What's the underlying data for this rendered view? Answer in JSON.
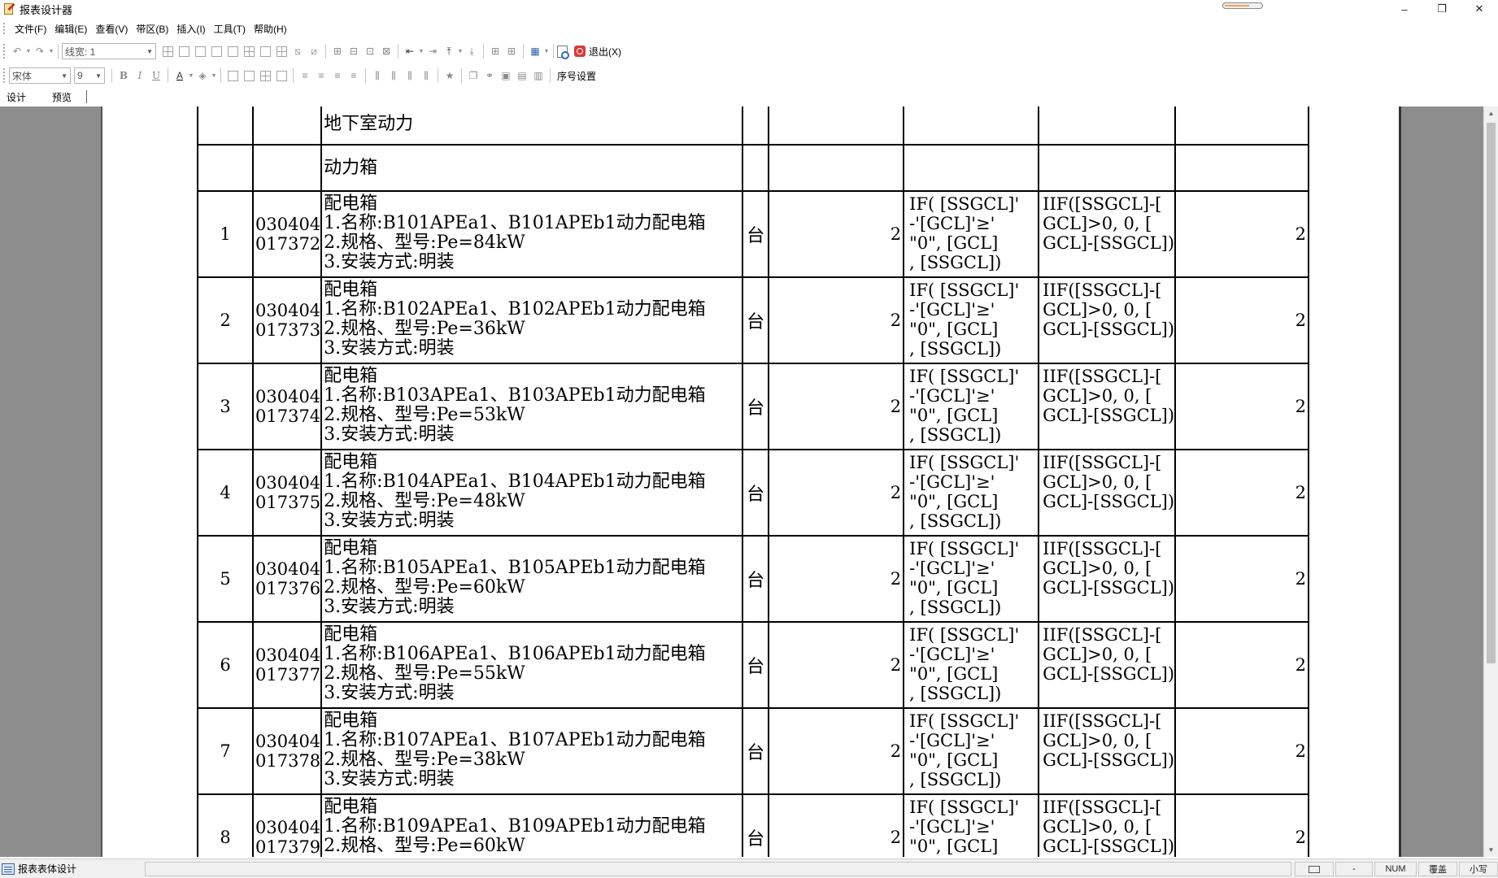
{
  "window": {
    "title": "报表设计器",
    "controls": {
      "minimize": "–",
      "restore": "❐",
      "close": "✕"
    }
  },
  "menu": [
    {
      "label": "文件(F)"
    },
    {
      "label": "编辑(E)"
    },
    {
      "label": "查看(V)"
    },
    {
      "label": "带区(B)"
    },
    {
      "label": "插入(I)"
    },
    {
      "label": "工具(T)"
    },
    {
      "label": "帮助(H)"
    }
  ],
  "toolbar1": {
    "line_width_combo": "线宽: 1",
    "exit_label": "退出(X)"
  },
  "toolbar2": {
    "font_combo": "宋体",
    "size_combo": "9",
    "bold": "B",
    "italic": "I",
    "underline": "U",
    "font_color": "A",
    "sequence_label": "序号设置"
  },
  "tabs": [
    {
      "label": "设计"
    },
    {
      "label": "预览"
    }
  ],
  "report": {
    "section_rows": [
      {
        "name": "地下室动力"
      },
      {
        "name": "动力箱"
      }
    ],
    "formula_1": "IF( [SSGCL]'\n-'[GCL]'≥'\n\"0\", [GCL]\n, [SSGCL])",
    "formula_2": "IIF([SSGCL]-[\nGCL]>0, 0, [\nGCL]-[SSGCL])",
    "items": [
      {
        "no": "1",
        "code_a": "030404",
        "code_b": "017372",
        "name": "配电箱",
        "spec1": "1.名称:B101APEa1、B101APEb1动力配电箱",
        "spec2": "2.规格、型号:Pe=84kW",
        "spec3": "3.安装方式:明装",
        "unit": "台",
        "qty": "2",
        "total": "2"
      },
      {
        "no": "2",
        "code_a": "030404",
        "code_b": "017373",
        "name": "配电箱",
        "spec1": "1.名称:B102APEa1、B102APEb1动力配电箱",
        "spec2": "2.规格、型号:Pe=36kW",
        "spec3": "3.安装方式:明装",
        "unit": "台",
        "qty": "2",
        "total": "2"
      },
      {
        "no": "3",
        "code_a": "030404",
        "code_b": "017374",
        "name": "配电箱",
        "spec1": "1.名称:B103APEa1、B103APEb1动力配电箱",
        "spec2": "2.规格、型号:Pe=53kW",
        "spec3": "3.安装方式:明装",
        "unit": "台",
        "qty": "2",
        "total": "2"
      },
      {
        "no": "4",
        "code_a": "030404",
        "code_b": "017375",
        "name": "配电箱",
        "spec1": "1.名称:B104APEa1、B104APEb1动力配电箱",
        "spec2": "2.规格、型号:Pe=48kW",
        "spec3": "3.安装方式:明装",
        "unit": "台",
        "qty": "2",
        "total": "2"
      },
      {
        "no": "5",
        "code_a": "030404",
        "code_b": "017376",
        "name": "配电箱",
        "spec1": "1.名称:B105APEa1、B105APEb1动力配电箱",
        "spec2": "2.规格、型号:Pe=60kW",
        "spec3": "3.安装方式:明装",
        "unit": "台",
        "qty": "2",
        "total": "2"
      },
      {
        "no": "6",
        "code_a": "030404",
        "code_b": "017377",
        "name": "配电箱",
        "spec1": "1.名称:B106APEa1、B106APEb1动力配电箱",
        "spec2": "2.规格、型号:Pe=55kW",
        "spec3": "3.安装方式:明装",
        "unit": "台",
        "qty": "2",
        "total": "2"
      },
      {
        "no": "7",
        "code_a": "030404",
        "code_b": "017378",
        "name": "配电箱",
        "spec1": "1.名称:B107APEa1、B107APEb1动力配电箱",
        "spec2": "2.规格、型号:Pe=38kW",
        "spec3": "3.安装方式:明装",
        "unit": "台",
        "qty": "2",
        "total": "2"
      },
      {
        "no": "8",
        "code_a": "030404",
        "code_b": "017379",
        "name": "配电箱",
        "spec1": "1.名称:B109APEa1、B109APEb1动力配电箱",
        "spec2": "2.规格、型号:Pe=60kW",
        "spec3": "",
        "unit": "台",
        "qty": "2",
        "total": "2"
      }
    ]
  },
  "status": {
    "text": "报表表体设计",
    "num": "NUM",
    "overwrite": "覆盖",
    "lowercase": "小写"
  }
}
